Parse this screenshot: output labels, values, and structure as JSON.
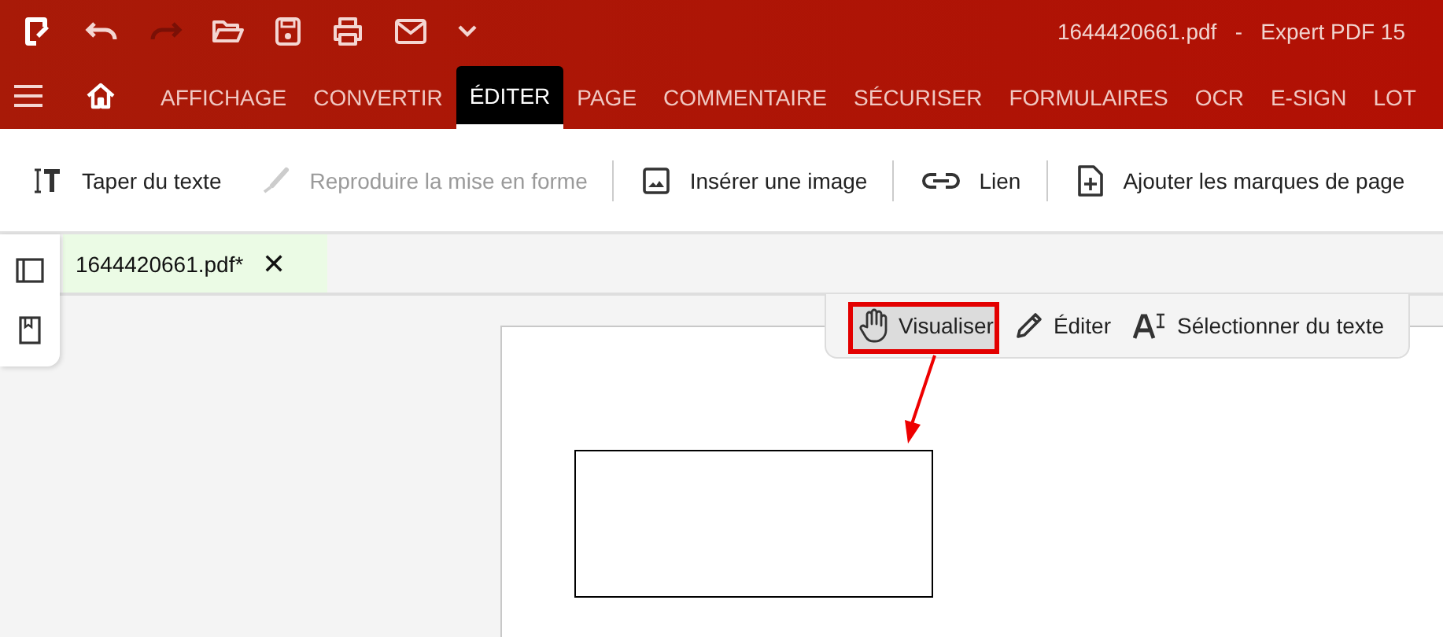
{
  "window": {
    "title": "1644420661.pdf   -   Expert PDF 15"
  },
  "ribbon_tabs": [
    {
      "label": "AFFICHAGE",
      "selected": false
    },
    {
      "label": "CONVERTIR",
      "selected": false
    },
    {
      "label": "ÉDITER",
      "selected": true
    },
    {
      "label": "PAGE",
      "selected": false
    },
    {
      "label": "COMMENTAIRE",
      "selected": false
    },
    {
      "label": "SÉCURISER",
      "selected": false
    },
    {
      "label": "FORMULAIRES",
      "selected": false
    },
    {
      "label": "OCR",
      "selected": false
    },
    {
      "label": "E-SIGN",
      "selected": false
    },
    {
      "label": "LOT",
      "selected": false
    }
  ],
  "toolbar_groups": [
    [
      {
        "label": "Taper du texte",
        "disabled": false
      },
      {
        "label": "Reproduire la mise en forme",
        "disabled": true
      }
    ],
    [
      {
        "label": "Insérer une image",
        "disabled": false
      }
    ],
    [
      {
        "label": "Lien",
        "disabled": false
      }
    ],
    [
      {
        "label": "Ajouter les marques de page",
        "disabled": false
      }
    ]
  ],
  "document_tab": {
    "label": "1644420661.pdf*",
    "close": "✕"
  },
  "mode_toolbar": [
    {
      "label": "Visualiser",
      "selected": true
    },
    {
      "label": "Éditer",
      "selected": false
    },
    {
      "label": "Sélectionner du texte",
      "selected": false
    }
  ]
}
